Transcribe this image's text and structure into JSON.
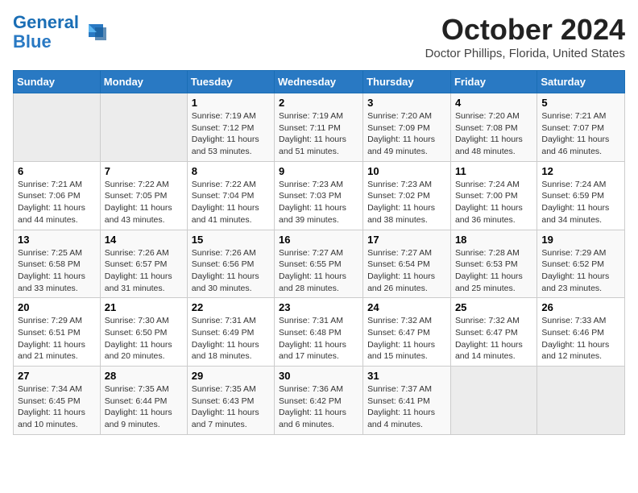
{
  "logo": {
    "line1": "General",
    "line2": "Blue"
  },
  "title": "October 2024",
  "location": "Doctor Phillips, Florida, United States",
  "headers": [
    "Sunday",
    "Monday",
    "Tuesday",
    "Wednesday",
    "Thursday",
    "Friday",
    "Saturday"
  ],
  "weeks": [
    [
      {
        "day": "",
        "sunrise": "",
        "sunset": "",
        "daylight": ""
      },
      {
        "day": "",
        "sunrise": "",
        "sunset": "",
        "daylight": ""
      },
      {
        "day": "1",
        "sunrise": "Sunrise: 7:19 AM",
        "sunset": "Sunset: 7:12 PM",
        "daylight": "Daylight: 11 hours and 53 minutes."
      },
      {
        "day": "2",
        "sunrise": "Sunrise: 7:19 AM",
        "sunset": "Sunset: 7:11 PM",
        "daylight": "Daylight: 11 hours and 51 minutes."
      },
      {
        "day": "3",
        "sunrise": "Sunrise: 7:20 AM",
        "sunset": "Sunset: 7:09 PM",
        "daylight": "Daylight: 11 hours and 49 minutes."
      },
      {
        "day": "4",
        "sunrise": "Sunrise: 7:20 AM",
        "sunset": "Sunset: 7:08 PM",
        "daylight": "Daylight: 11 hours and 48 minutes."
      },
      {
        "day": "5",
        "sunrise": "Sunrise: 7:21 AM",
        "sunset": "Sunset: 7:07 PM",
        "daylight": "Daylight: 11 hours and 46 minutes."
      }
    ],
    [
      {
        "day": "6",
        "sunrise": "Sunrise: 7:21 AM",
        "sunset": "Sunset: 7:06 PM",
        "daylight": "Daylight: 11 hours and 44 minutes."
      },
      {
        "day": "7",
        "sunrise": "Sunrise: 7:22 AM",
        "sunset": "Sunset: 7:05 PM",
        "daylight": "Daylight: 11 hours and 43 minutes."
      },
      {
        "day": "8",
        "sunrise": "Sunrise: 7:22 AM",
        "sunset": "Sunset: 7:04 PM",
        "daylight": "Daylight: 11 hours and 41 minutes."
      },
      {
        "day": "9",
        "sunrise": "Sunrise: 7:23 AM",
        "sunset": "Sunset: 7:03 PM",
        "daylight": "Daylight: 11 hours and 39 minutes."
      },
      {
        "day": "10",
        "sunrise": "Sunrise: 7:23 AM",
        "sunset": "Sunset: 7:02 PM",
        "daylight": "Daylight: 11 hours and 38 minutes."
      },
      {
        "day": "11",
        "sunrise": "Sunrise: 7:24 AM",
        "sunset": "Sunset: 7:00 PM",
        "daylight": "Daylight: 11 hours and 36 minutes."
      },
      {
        "day": "12",
        "sunrise": "Sunrise: 7:24 AM",
        "sunset": "Sunset: 6:59 PM",
        "daylight": "Daylight: 11 hours and 34 minutes."
      }
    ],
    [
      {
        "day": "13",
        "sunrise": "Sunrise: 7:25 AM",
        "sunset": "Sunset: 6:58 PM",
        "daylight": "Daylight: 11 hours and 33 minutes."
      },
      {
        "day": "14",
        "sunrise": "Sunrise: 7:26 AM",
        "sunset": "Sunset: 6:57 PM",
        "daylight": "Daylight: 11 hours and 31 minutes."
      },
      {
        "day": "15",
        "sunrise": "Sunrise: 7:26 AM",
        "sunset": "Sunset: 6:56 PM",
        "daylight": "Daylight: 11 hours and 30 minutes."
      },
      {
        "day": "16",
        "sunrise": "Sunrise: 7:27 AM",
        "sunset": "Sunset: 6:55 PM",
        "daylight": "Daylight: 11 hours and 28 minutes."
      },
      {
        "day": "17",
        "sunrise": "Sunrise: 7:27 AM",
        "sunset": "Sunset: 6:54 PM",
        "daylight": "Daylight: 11 hours and 26 minutes."
      },
      {
        "day": "18",
        "sunrise": "Sunrise: 7:28 AM",
        "sunset": "Sunset: 6:53 PM",
        "daylight": "Daylight: 11 hours and 25 minutes."
      },
      {
        "day": "19",
        "sunrise": "Sunrise: 7:29 AM",
        "sunset": "Sunset: 6:52 PM",
        "daylight": "Daylight: 11 hours and 23 minutes."
      }
    ],
    [
      {
        "day": "20",
        "sunrise": "Sunrise: 7:29 AM",
        "sunset": "Sunset: 6:51 PM",
        "daylight": "Daylight: 11 hours and 21 minutes."
      },
      {
        "day": "21",
        "sunrise": "Sunrise: 7:30 AM",
        "sunset": "Sunset: 6:50 PM",
        "daylight": "Daylight: 11 hours and 20 minutes."
      },
      {
        "day": "22",
        "sunrise": "Sunrise: 7:31 AM",
        "sunset": "Sunset: 6:49 PM",
        "daylight": "Daylight: 11 hours and 18 minutes."
      },
      {
        "day": "23",
        "sunrise": "Sunrise: 7:31 AM",
        "sunset": "Sunset: 6:48 PM",
        "daylight": "Daylight: 11 hours and 17 minutes."
      },
      {
        "day": "24",
        "sunrise": "Sunrise: 7:32 AM",
        "sunset": "Sunset: 6:47 PM",
        "daylight": "Daylight: 11 hours and 15 minutes."
      },
      {
        "day": "25",
        "sunrise": "Sunrise: 7:32 AM",
        "sunset": "Sunset: 6:47 PM",
        "daylight": "Daylight: 11 hours and 14 minutes."
      },
      {
        "day": "26",
        "sunrise": "Sunrise: 7:33 AM",
        "sunset": "Sunset: 6:46 PM",
        "daylight": "Daylight: 11 hours and 12 minutes."
      }
    ],
    [
      {
        "day": "27",
        "sunrise": "Sunrise: 7:34 AM",
        "sunset": "Sunset: 6:45 PM",
        "daylight": "Daylight: 11 hours and 10 minutes."
      },
      {
        "day": "28",
        "sunrise": "Sunrise: 7:35 AM",
        "sunset": "Sunset: 6:44 PM",
        "daylight": "Daylight: 11 hours and 9 minutes."
      },
      {
        "day": "29",
        "sunrise": "Sunrise: 7:35 AM",
        "sunset": "Sunset: 6:43 PM",
        "daylight": "Daylight: 11 hours and 7 minutes."
      },
      {
        "day": "30",
        "sunrise": "Sunrise: 7:36 AM",
        "sunset": "Sunset: 6:42 PM",
        "daylight": "Daylight: 11 hours and 6 minutes."
      },
      {
        "day": "31",
        "sunrise": "Sunrise: 7:37 AM",
        "sunset": "Sunset: 6:41 PM",
        "daylight": "Daylight: 11 hours and 4 minutes."
      },
      {
        "day": "",
        "sunrise": "",
        "sunset": "",
        "daylight": ""
      },
      {
        "day": "",
        "sunrise": "",
        "sunset": "",
        "daylight": ""
      }
    ]
  ]
}
